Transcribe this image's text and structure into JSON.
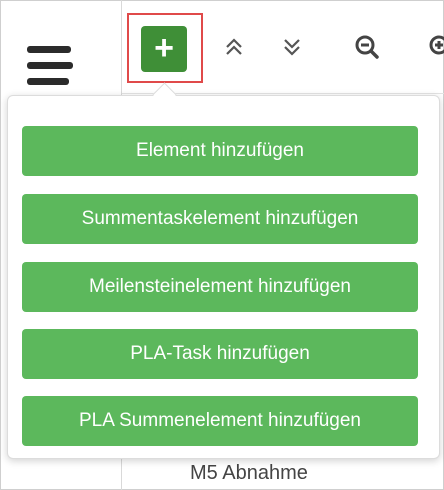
{
  "toolbar": {
    "add_button_label": "+",
    "icons": [
      "hamburger-menu-icon",
      "chevron-double-up-icon",
      "chevron-double-down-icon",
      "zoom-out-icon",
      "zoom-in-icon"
    ],
    "add_button_color": "#3f8f37",
    "highlight_color": "#e04a4a"
  },
  "menu": {
    "item_color": "#5cb85c",
    "items": [
      {
        "label": "Element hinzufügen"
      },
      {
        "label": "Summentaskelement hinzufügen"
      },
      {
        "label": "Meilensteinelement hinzufügen"
      },
      {
        "label": "PLA-Task hinzufügen"
      },
      {
        "label": "PLA Summenelement hinzufügen"
      }
    ]
  },
  "background": {
    "partial_row_text": "M5 Abnahme"
  }
}
